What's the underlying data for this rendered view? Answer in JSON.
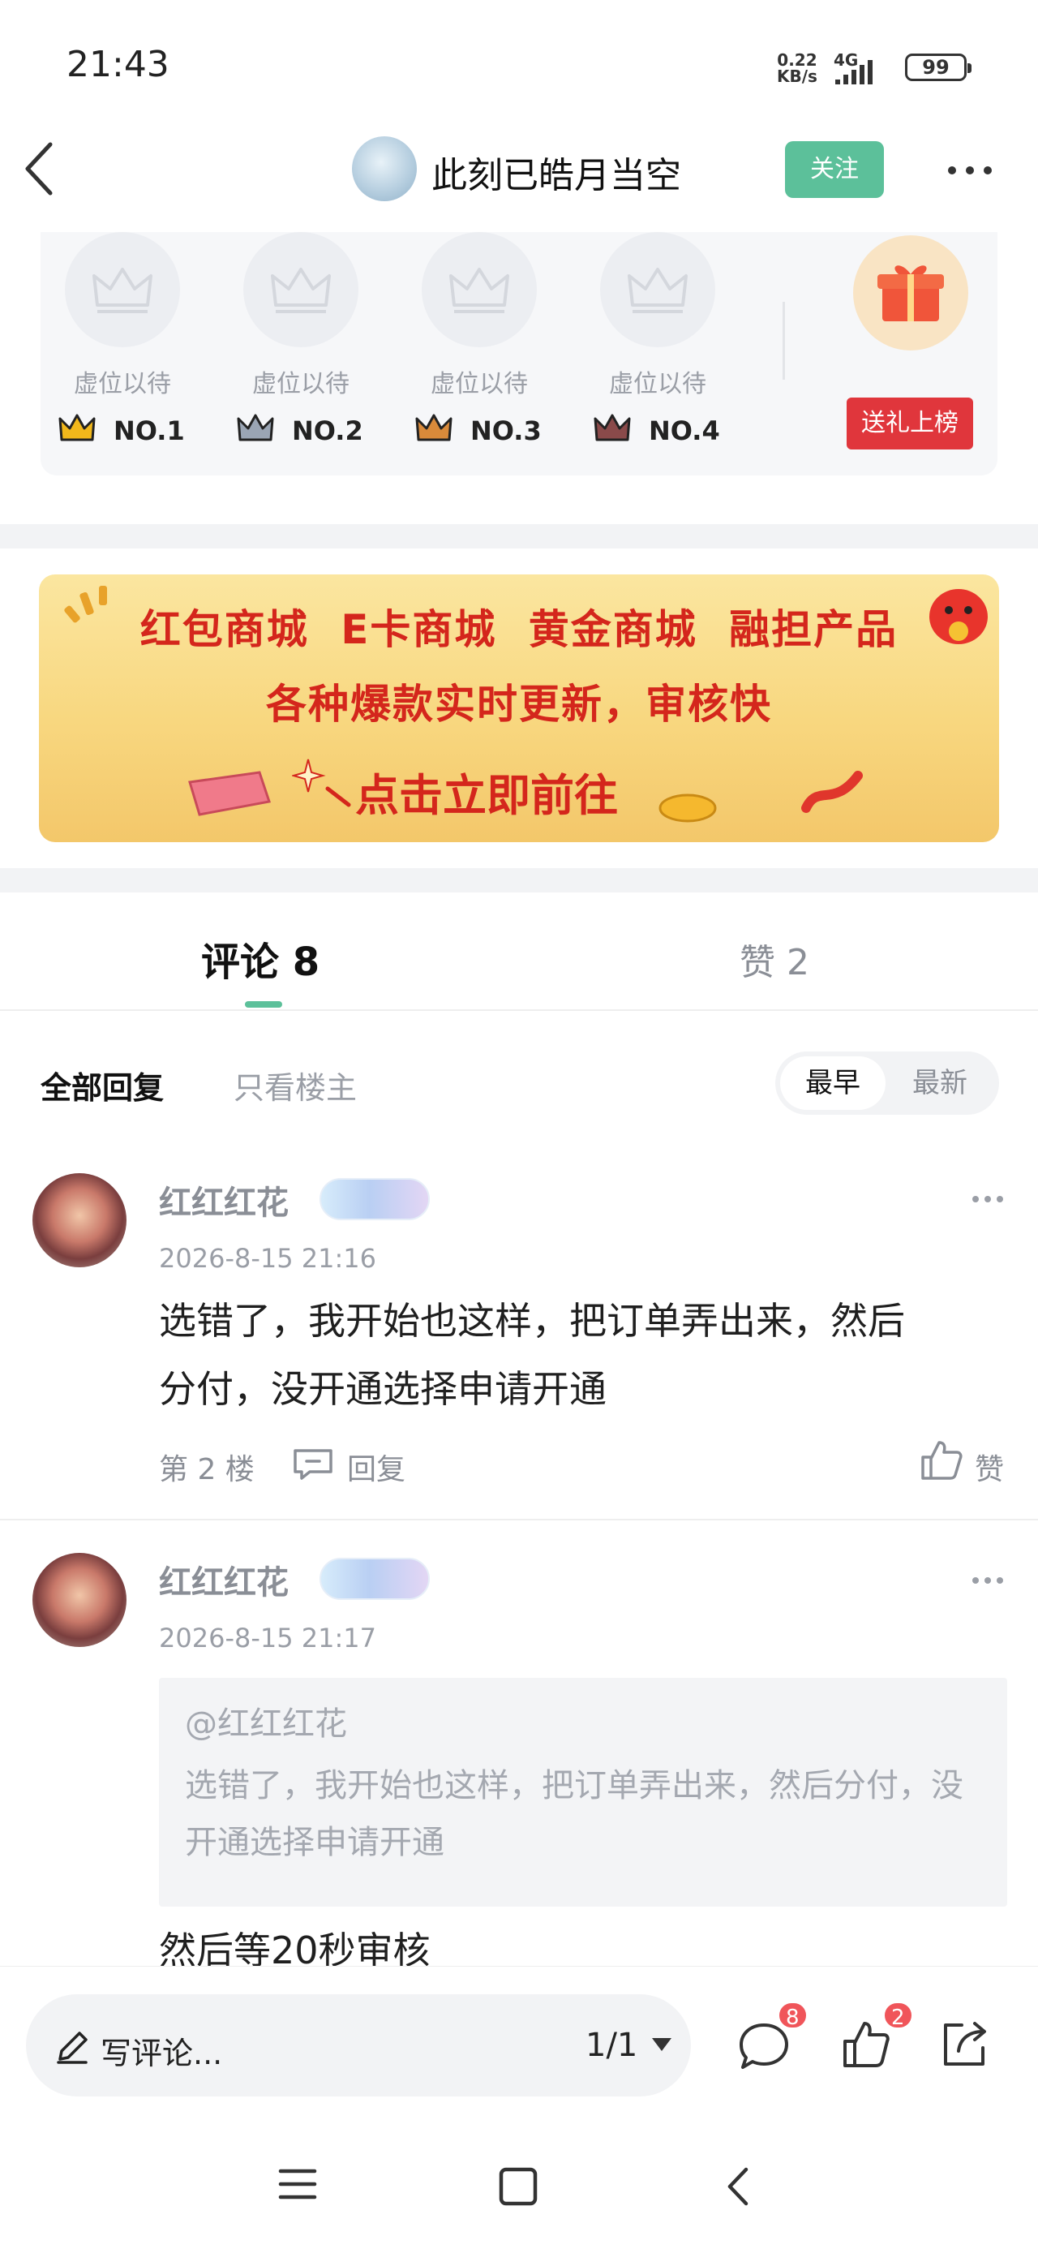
{
  "status_bar": {
    "time": "21:43",
    "net_speed_value": "0.22",
    "net_speed_unit": "KB/s",
    "network": "4G",
    "battery": "99"
  },
  "header": {
    "author_name": "此刻已皓月当空",
    "follow_label": "关注"
  },
  "gift_rank": {
    "slots": [
      {
        "label": "虚位以待",
        "rank": "NO.1",
        "color": "#f2b81b"
      },
      {
        "label": "虚位以待",
        "rank": "NO.2",
        "color": "#9aa5b4"
      },
      {
        "label": "虚位以待",
        "rank": "NO.3",
        "color": "#d98a3a"
      },
      {
        "label": "虚位以待",
        "rank": "NO.4",
        "color": "#8a4a4a"
      }
    ],
    "gift_button": "送礼上榜"
  },
  "banner": {
    "line1": "红包商城 E卡商城 黄金商城 融担产品",
    "line2": "各种爆款实时更新，审核快",
    "cta": "点击立即前往"
  },
  "tabs": {
    "comments": "评论 8",
    "likes": "赞 2"
  },
  "filters": {
    "all": "全部回复",
    "op_only": "只看楼主",
    "sort_earliest": "最早",
    "sort_latest": "最新"
  },
  "comments": [
    {
      "name": "红红红花",
      "time": "2026-8-15 21:16",
      "text_line1": "选错了，我开始也这样，把订单弄出来，然后",
      "text_line2": "分付，没开通选择申请开通",
      "floor": "第 2 楼",
      "reply": "回复",
      "like": "赞"
    },
    {
      "name": "红红红花",
      "time": "2026-8-15 21:17",
      "quote_author": "@红红红花",
      "quote_text": "选错了，我开始也这样，把订单弄出来，然后分付，没开通选择申请开通",
      "text": "然后等20秒审核"
    }
  ],
  "bottom_bar": {
    "write_placeholder": "写评论...",
    "page_indicator": "1/1",
    "comment_count": "8",
    "like_count": "2"
  },
  "colors": {
    "accent_green": "#5cc09a",
    "gift_red": "#e0363c",
    "badge_red": "#f0555a"
  }
}
